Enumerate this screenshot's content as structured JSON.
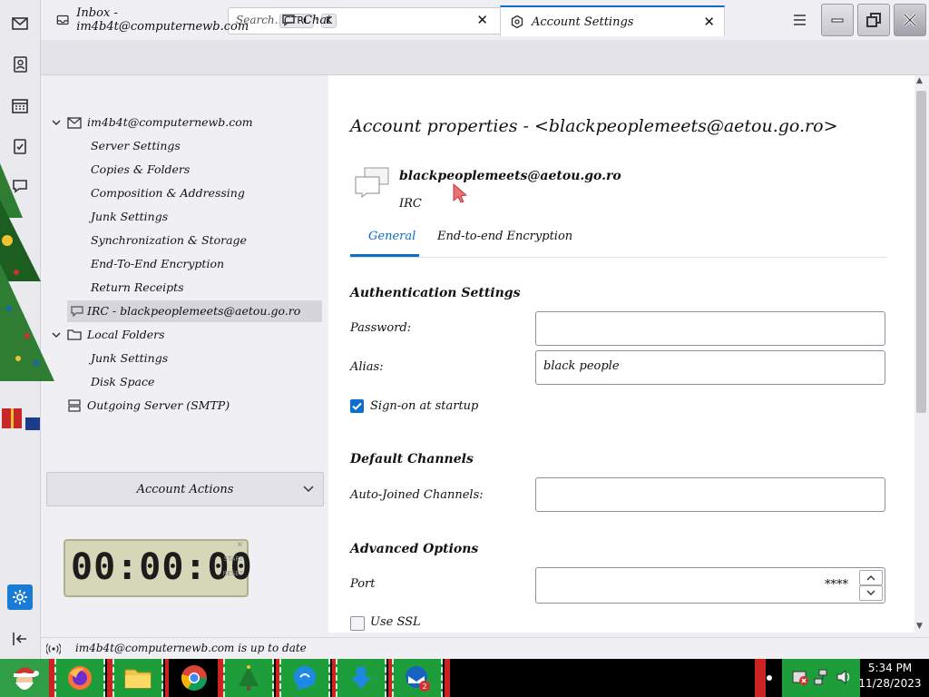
{
  "search": {
    "placeholder": "Search...",
    "key1": "CTRL",
    "key2": "K"
  },
  "tabs": [
    {
      "label": "Inbox - im4b4t@computernewb.com"
    },
    {
      "label": "Chat"
    },
    {
      "label": "Account Settings"
    }
  ],
  "tree": {
    "account": "im4b4t@computernewb.com",
    "items": [
      "Server Settings",
      "Copies & Folders",
      "Composition & Addressing",
      "Junk Settings",
      "Synchronization & Storage",
      "End-To-End Encryption",
      "Return Receipts"
    ],
    "irc_account": "IRC - blackpeoplemeets@aetou.go.ro",
    "local_folders": "Local Folders",
    "local_items": [
      "Junk Settings",
      "Disk Space"
    ],
    "outgoing": "Outgoing Server (SMTP)"
  },
  "account_actions": "Account Actions",
  "clock": {
    "digits": "00:00:00",
    "start": "START",
    "reset": "RESET"
  },
  "main": {
    "heading": "Account properties - <blackpeoplemeets@aetou.go.ro>",
    "identity_name": "blackpeoplemeets@aetou.go.ro",
    "identity_proto": "IRC",
    "tab_general": "General",
    "tab_e2e": "End-to-end Encryption",
    "auth_section": "Authentication Settings",
    "password_label": "Password:",
    "password_value": "",
    "alias_label": "Alias:",
    "alias_value": "black people",
    "signon_label": "Sign-on at startup",
    "signon_checked": true,
    "channels_section": "Default Channels",
    "autojoin_label": "Auto-Joined Channels:",
    "autojoin_value": "",
    "advanced_section": "Advanced Options",
    "port_label": "Port",
    "port_value": "****",
    "ssl_label": "Use SSL",
    "ssl_checked": false
  },
  "status": {
    "text": "im4b4t@computernewb.com is up to date"
  },
  "taskbar": {
    "time": "5:34 PM",
    "date": "11/28/2023",
    "badge": "2"
  },
  "colors": {
    "accent": "#0a6ed1",
    "taskbar_green": "#1e9e3a"
  }
}
